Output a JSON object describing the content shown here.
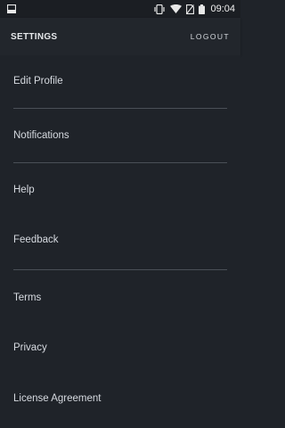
{
  "status_bar": {
    "time": "09:04",
    "icons": [
      "notification-box-icon",
      "vibrate-icon",
      "wifi-icon",
      "no-sim-icon",
      "battery-icon"
    ]
  },
  "header": {
    "title": "SETTINGS",
    "logout_label": "LOGOUT"
  },
  "settings": {
    "items": [
      {
        "label": "Edit Profile"
      },
      {
        "label": "Notifications"
      },
      {
        "label": "Help"
      },
      {
        "label": "Feedback"
      },
      {
        "label": "Terms"
      },
      {
        "label": "Privacy"
      },
      {
        "label": "License Agreement"
      }
    ]
  },
  "colors": {
    "background": "#1f2329",
    "app_bar": "#22262c",
    "status_bar": "#1b1e23",
    "text": "#d6dae0",
    "divider": "#4a4f57"
  }
}
